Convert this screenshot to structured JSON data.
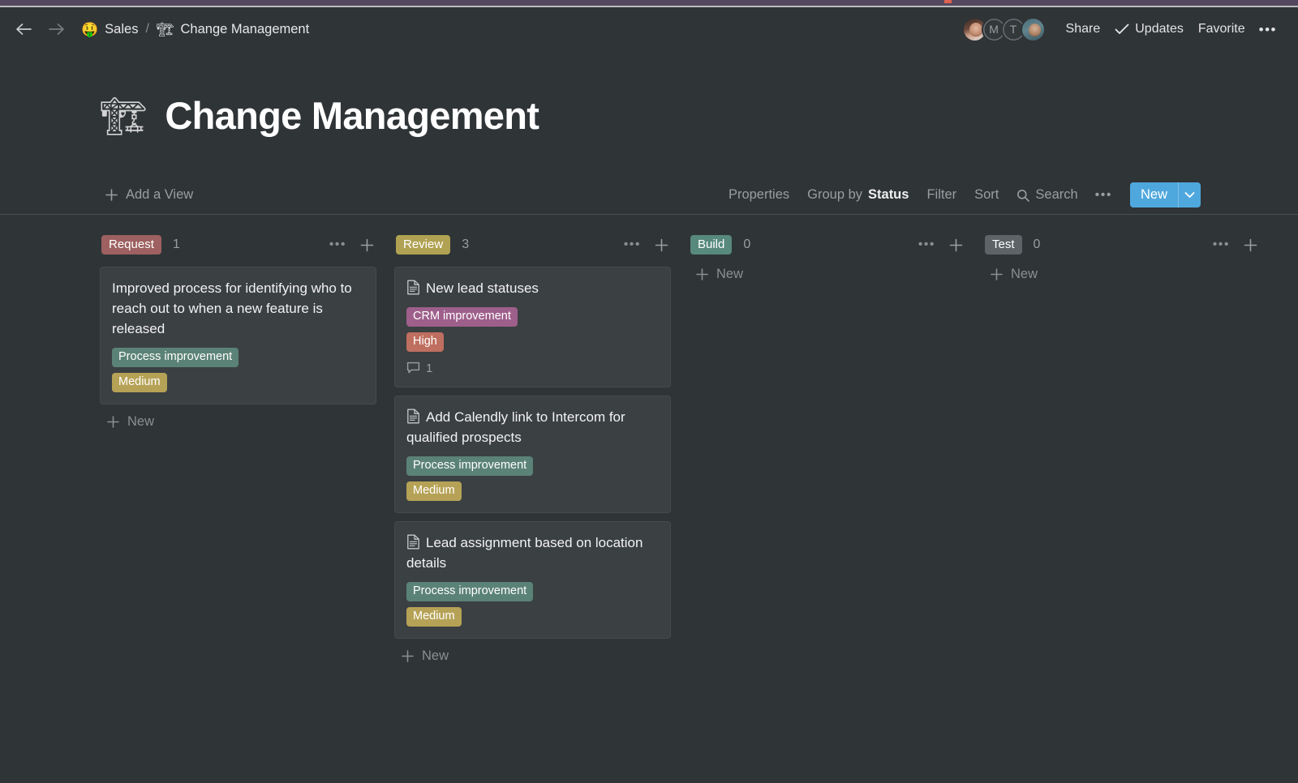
{
  "browser": {
    "chrome_color": "#55485e",
    "mark_color": "#e0614f"
  },
  "topbar": {
    "back_icon": "arrow-left-icon",
    "forward_icon": "arrow-right-icon",
    "breadcrumb": {
      "workspace_emoji": "🤑",
      "workspace": "Sales",
      "separator": "/",
      "page_emoji": "🏗",
      "page": "Change Management"
    },
    "avatars": [
      {
        "type": "photo",
        "label": ""
      },
      {
        "type": "initial",
        "label": "M"
      },
      {
        "type": "initial",
        "label": "T"
      },
      {
        "type": "photo",
        "label": ""
      }
    ],
    "share_label": "Share",
    "updates_label": "Updates",
    "updates_icon": "check-icon",
    "favorite_label": "Favorite",
    "more_label": "•••"
  },
  "page": {
    "icon": "🏗",
    "title": "Change Management"
  },
  "view_bar": {
    "add_view_label": "Add a View",
    "properties_label": "Properties",
    "group_by_prefix": "Group by",
    "group_by_value": "Status",
    "filter_label": "Filter",
    "sort_label": "Sort",
    "search_label": "Search",
    "search_icon": "search-icon",
    "more_label": "•••",
    "new_label": "New",
    "new_caret_icon": "chevron-down-icon",
    "new_button_color": "#4fa8dd"
  },
  "board": {
    "new_item_label": "New",
    "column_more_label": "•••",
    "columns": [
      {
        "status": "Request",
        "status_color": "#9e6060",
        "count": "1",
        "cards": [
          {
            "title": "Improved process for identifying who to reach out to when a new feature is released",
            "has_doc_icon": false,
            "tags": [
              {
                "label": "Process improvement",
                "color": "#5b8276"
              },
              {
                "label": "Medium",
                "color": "#b6a256"
              }
            ],
            "comments": null
          }
        ]
      },
      {
        "status": "Review",
        "status_color": "#b0a252",
        "count": "3",
        "cards": [
          {
            "title": "New lead statuses",
            "has_doc_icon": true,
            "tags": [
              {
                "label": "CRM improvement",
                "color": "#9e5f8b"
              },
              {
                "label": "High",
                "color": "#bf6f5f"
              }
            ],
            "comments": "1"
          },
          {
            "title": "Add Calendly link to Intercom for qualified prospects",
            "has_doc_icon": true,
            "tags": [
              {
                "label": "Process improvement",
                "color": "#5b8276"
              },
              {
                "label": "Medium",
                "color": "#b6a256"
              }
            ],
            "comments": null
          },
          {
            "title": "Lead assignment based on location details",
            "has_doc_icon": true,
            "tags": [
              {
                "label": "Process improvement",
                "color": "#5b8276"
              },
              {
                "label": "Medium",
                "color": "#b6a256"
              }
            ],
            "comments": null
          }
        ]
      },
      {
        "status": "Build",
        "status_color": "#57897c",
        "count": "0",
        "cards": []
      },
      {
        "status": "Test",
        "status_color": "#5d6366",
        "count": "0",
        "cards": []
      }
    ]
  }
}
